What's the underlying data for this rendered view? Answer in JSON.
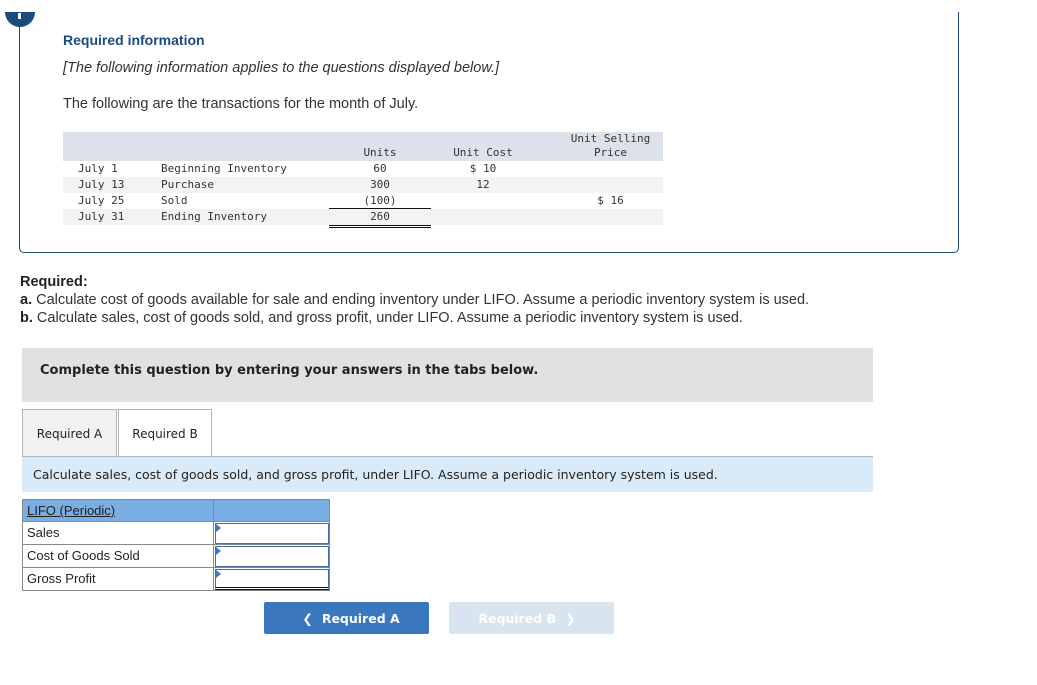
{
  "info": {
    "title": "Required information",
    "note": "[The following information applies to the questions displayed below.]",
    "intro": "The following are the transactions for the month of July."
  },
  "transactions": {
    "headers": {
      "units": "Units",
      "unit_cost": "Unit Cost",
      "unit_selling_price_line1": "Unit Selling",
      "unit_selling_price_line2": "Price"
    },
    "rows": [
      {
        "date": "July 1",
        "description": "Beginning Inventory",
        "units": "60",
        "unit_cost": "$ 10",
        "unit_price": ""
      },
      {
        "date": "July 13",
        "description": "Purchase",
        "units": "300",
        "unit_cost": "12",
        "unit_price": ""
      },
      {
        "date": "July 25",
        "description": "Sold",
        "units": "(100)",
        "unit_cost": "",
        "unit_price": "$ 16"
      },
      {
        "date": "July 31",
        "description": "Ending Inventory",
        "units": "260",
        "unit_cost": "",
        "unit_price": ""
      }
    ]
  },
  "required": {
    "heading": "Required:",
    "items": [
      {
        "letter": "a.",
        "text": " Calculate cost of goods available for sale and ending inventory under LIFO. Assume a periodic inventory system is used."
      },
      {
        "letter": "b.",
        "text": " Calculate sales, cost of goods sold, and gross profit, under LIFO. Assume a periodic inventory system is used."
      }
    ]
  },
  "instruction": "Complete this question by entering your answers in the tabs below.",
  "tabs": [
    {
      "label": "Required A",
      "active": false
    },
    {
      "label": "Required B",
      "active": true
    }
  ],
  "panel": {
    "description": "Calculate sales, cost of goods sold, and gross profit, under LIFO. Assume a periodic inventory system is used.",
    "table_header": "LIFO (Periodic)",
    "rows": [
      {
        "label": "Sales",
        "value": ""
      },
      {
        "label": "Cost of Goods Sold",
        "value": ""
      },
      {
        "label": "Gross Profit",
        "value": ""
      }
    ]
  },
  "nav": {
    "prev_label": "Required A",
    "next_label": "Required B"
  },
  "colors": {
    "brand_navy": "#1b4a80",
    "button_blue": "#3a77be",
    "button_disabled": "#d9e4f1",
    "table_header_blue": "#7aaee3",
    "panel_desc_bg": "#d9ebf8"
  }
}
